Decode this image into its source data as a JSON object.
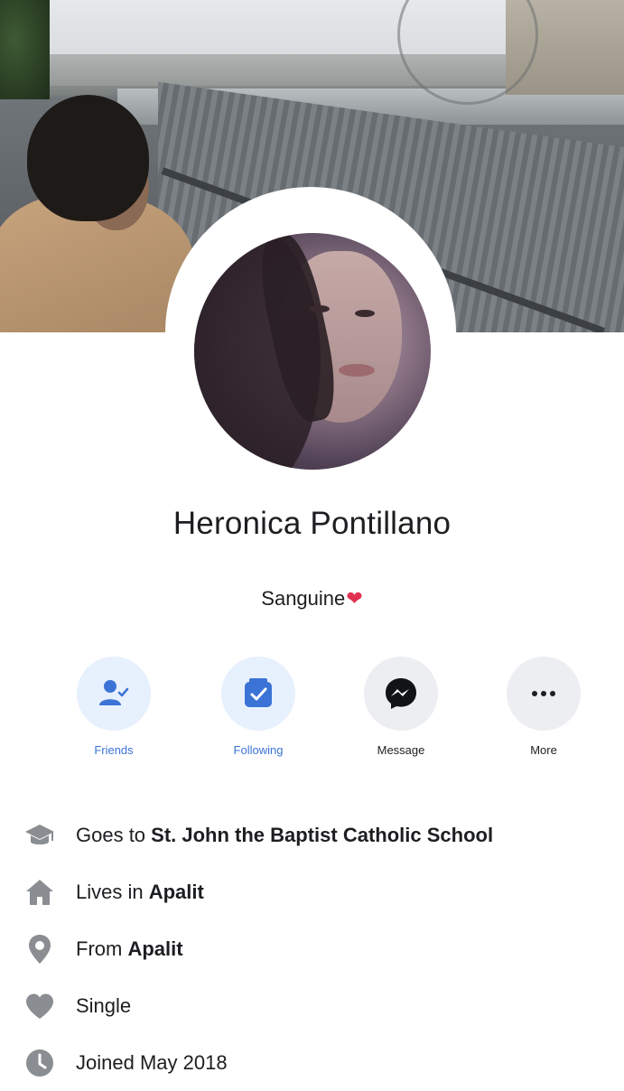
{
  "profile": {
    "name": "Heronica Pontillano",
    "bio": "Sanguine",
    "bio_emoji": "❤"
  },
  "actions": [
    {
      "label": "Friends",
      "icon": "friends-icon",
      "style": "blue"
    },
    {
      "label": "Following",
      "icon": "following-icon",
      "style": "blue"
    },
    {
      "label": "Message",
      "icon": "messenger-icon",
      "style": "grey"
    },
    {
      "label": "More",
      "icon": "more-icon",
      "style": "grey"
    }
  ],
  "intro": {
    "education": {
      "prefix": "Goes to ",
      "value": "St. John the Baptist Catholic School",
      "icon": "graduation-cap-icon"
    },
    "lives": {
      "prefix": "Lives in ",
      "value": "Apalit",
      "icon": "home-icon"
    },
    "from": {
      "prefix": "From ",
      "value": "Apalit",
      "icon": "location-pin-icon"
    },
    "relationship": {
      "text": "Single",
      "icon": "heart-icon"
    },
    "joined": {
      "text": "Joined May 2018",
      "icon": "clock-icon"
    }
  },
  "colors": {
    "accent_blue": "#3b74d6",
    "blue_bg": "#e7f0fd",
    "grey_bg": "#eceef1",
    "heart_red": "#e0314f",
    "icon_grey": "#8a8d91"
  }
}
